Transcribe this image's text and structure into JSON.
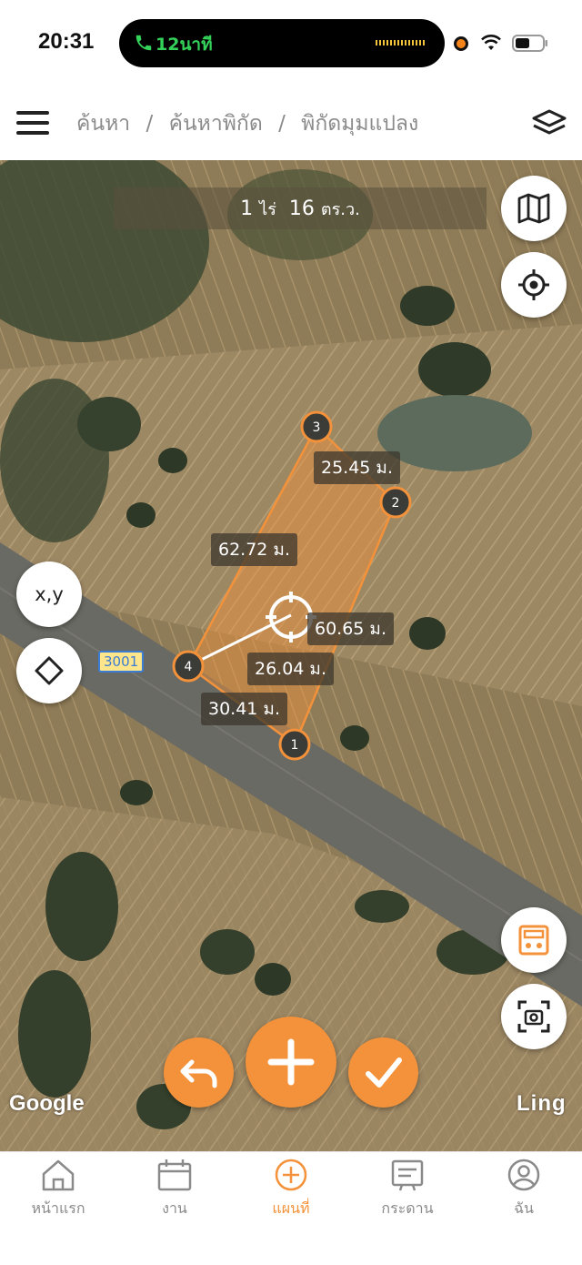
{
  "status_bar": {
    "time": "20:31",
    "call_duration": "12นาที",
    "icons": [
      "phone-icon",
      "wifi-icon",
      "battery-icon"
    ]
  },
  "header": {
    "breadcrumb": [
      "ค้นหา",
      "ค้นหาพิกัด",
      "พิกัดมุมแปลง"
    ],
    "separator": "/",
    "icons": [
      "hamburger-menu-icon",
      "layers-icon"
    ]
  },
  "map": {
    "area_value_rai": "1",
    "area_unit_rai": "ไร่",
    "area_value_wa": "16",
    "area_unit_wa": "ตร.ว.",
    "measurements": {
      "side_3_2": "25.45 ม.",
      "side_2_1": "60.65 ม.",
      "side_4_3": "62.72 ม.",
      "side_4_1": "30.41 ม.",
      "diagonal": "26.04 ม."
    },
    "vertices": [
      "1",
      "2",
      "3",
      "4"
    ],
    "road_label": "3001",
    "xy_button_label": "x,y",
    "attribution": "Google",
    "watermark": "Ling",
    "polygon_fill": "#f3923a",
    "accent_color": "#f3923a",
    "icons": [
      "map-icon",
      "locate-icon",
      "diamond-icon",
      "calculator-icon",
      "screenshot-icon",
      "undo-icon",
      "plus-icon",
      "check-icon",
      "crosshair-icon"
    ]
  },
  "bottom_nav": {
    "items": [
      {
        "label": "หน้าแรก",
        "icon": "home-icon"
      },
      {
        "label": "งาน",
        "icon": "calendar-icon"
      },
      {
        "label": "แผนที่",
        "icon": "add-circle-icon",
        "active": true
      },
      {
        "label": "กระดาน",
        "icon": "board-icon"
      },
      {
        "label": "ฉัน",
        "icon": "user-icon"
      }
    ],
    "active_color": "#f3923a"
  }
}
